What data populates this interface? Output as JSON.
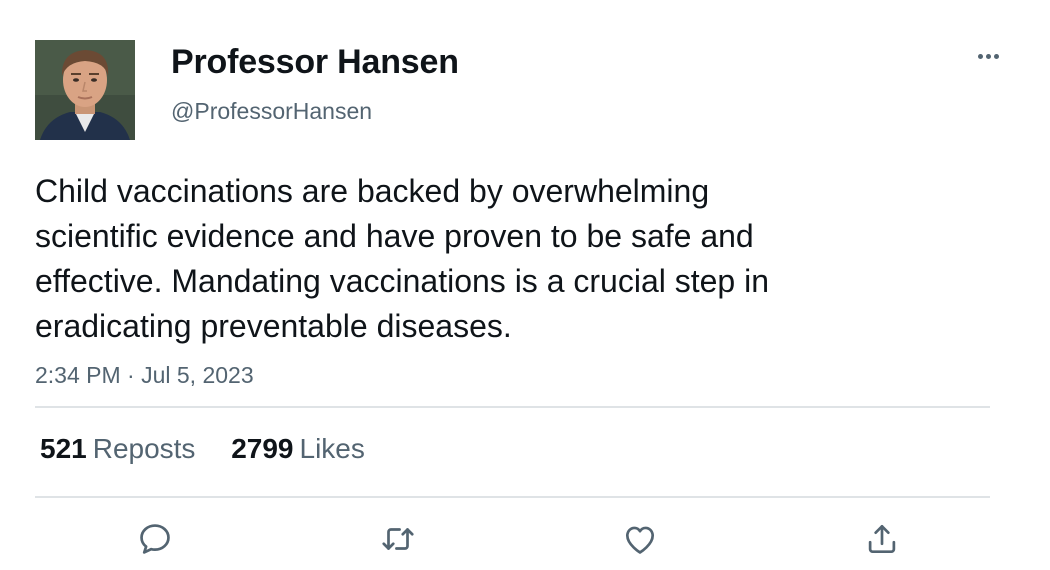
{
  "author": {
    "display_name": "Professor Hansen",
    "handle": "@ProfessorHansen",
    "avatar": "profile-photo"
  },
  "tweet": {
    "text": "Child vaccinations are backed by overwhelming\nscientific evidence and have proven to be safe and\neffective. Mandating vaccinations is a crucial step in\neradicating preventable diseases.",
    "timestamp": "2:34 PM · Jul 5, 2023"
  },
  "stats": {
    "reposts_count": "521",
    "reposts_label": "Reposts",
    "likes_count": "2799",
    "likes_label": "Likes"
  },
  "actions": [
    {
      "icon": "reply-icon"
    },
    {
      "icon": "repost-icon"
    },
    {
      "icon": "like-icon"
    },
    {
      "icon": "share-icon"
    }
  ],
  "menu": {
    "icon": "more-options-icon"
  },
  "colors": {
    "text_primary": "#0f1419",
    "text_secondary": "#536471",
    "divider": "#dfe3e6",
    "background": "#ffffff"
  }
}
